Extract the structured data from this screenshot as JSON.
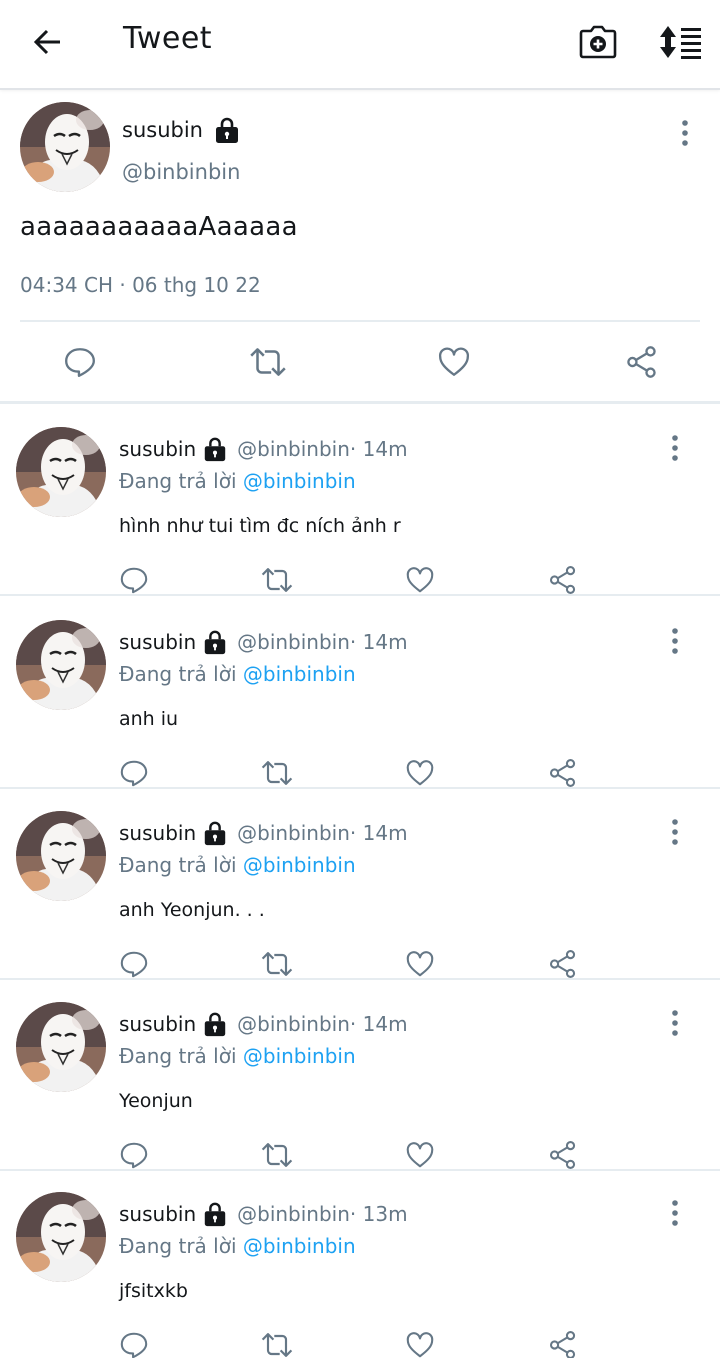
{
  "appbar": {
    "title": "Tweet",
    "icons": {
      "back": "arrow-left-icon",
      "camera": "camera-plus-icon",
      "sort": "sort-icon"
    }
  },
  "tweet": {
    "name": "susubin",
    "handle": "@binbinbin",
    "text": "aaaaaaaaaaaAaaaaa",
    "meta": "04:34 CH · 06 thg 10 22"
  },
  "replies": [
    {
      "name": "susubin",
      "handle": "@binbinbin",
      "time": " · 14m",
      "replying_prefix": "Đang trả lời ",
      "mention": "@binbinbin",
      "text": "hình như tui tìm đc ních ảnh r"
    },
    {
      "name": "susubin",
      "handle": "@binbinbin",
      "time": " · 14m",
      "replying_prefix": "Đang trả lời ",
      "mention": "@binbinbin",
      "text": "anh iu"
    },
    {
      "name": "susubin",
      "handle": "@binbinbin",
      "time": " · 14m",
      "replying_prefix": "Đang trả lời ",
      "mention": "@binbinbin",
      "text": "anh Yeonjun. . ."
    },
    {
      "name": "susubin",
      "handle": "@binbinbin",
      "time": " · 14m",
      "replying_prefix": "Đang trả lời ",
      "mention": "@binbinbin",
      "text": "Yeonjun"
    },
    {
      "name": "susubin",
      "handle": "@binbinbin",
      "time": " · 13m",
      "replying_prefix": "Đang trả lời ",
      "mention": "@binbinbin",
      "text": "jfsitxkb"
    }
  ],
  "colors": {
    "text": "#14171a",
    "secondary": "#657786",
    "link": "#1da1f2",
    "divider": "#e6ecf0"
  }
}
